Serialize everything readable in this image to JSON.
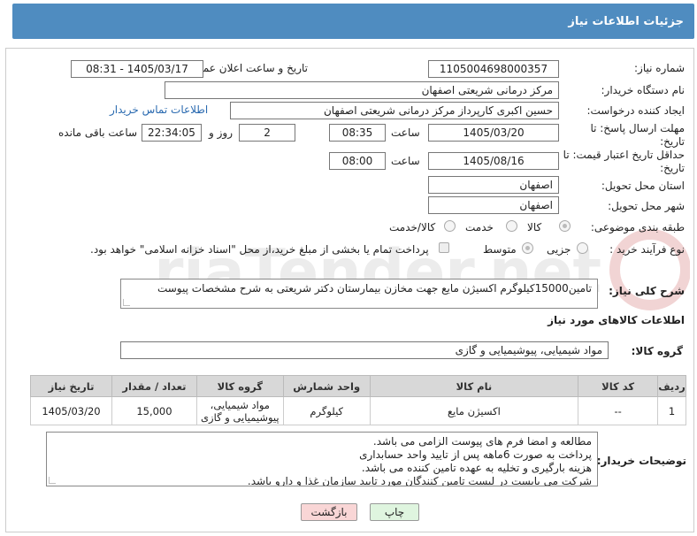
{
  "header": {
    "title": "جزئیات اطلاعات نیاز"
  },
  "form": {
    "need_number_label": "شماره نیاز:",
    "need_number": "1105004698000357",
    "announce_label": "تاریخ و ساعت اعلان عمومی:",
    "announce_value": "1405/03/17 - 08:31",
    "buyer_org_label": "نام دستگاه خریدار:",
    "buyer_org": "مرکز درمانی شریعتی اصفهان",
    "requester_label": "ایجاد کننده درخواست:",
    "requester": "حسین اکبری کارپرداز مرکز درمانی شریعتی اصفهان",
    "contact_link": "اطلاعات تماس خریدار",
    "deadline_label": "مهلت ارسال پاسخ: تا تاریخ:",
    "deadline_date": "1405/03/20",
    "time_label": "ساعت",
    "deadline_time": "08:35",
    "days_value": "2",
    "days_label": "روز و",
    "remaining_time": "22:34:05",
    "remaining_label": "ساعت باقی مانده",
    "price_valid_label": "حداقل تاریخ اعتبار قیمت: تا تاریخ:",
    "price_valid_date": "1405/08/16",
    "price_valid_time": "08:00",
    "province_label": "استان محل تحویل:",
    "province": "اصفهان",
    "city_label": "شهر محل تحویل:",
    "city": "اصفهان",
    "category_label": "طبقه بندی موضوعی:",
    "category_options": [
      "کالا",
      "خدمت",
      "کالا/خدمت"
    ],
    "process_label": "نوع فرآیند خرید :",
    "process_options": [
      "جزیی",
      "متوسط"
    ],
    "payment_note": "پرداخت تمام یا بخشی از مبلغ خرید،از محل \"اسناد خزانه اسلامی\" خواهد بود."
  },
  "summary": {
    "label": "شرح کلی نیاز:",
    "text": "تامین15000کیلوگرم اکسیژن مایع جهت مخازن بیمارستان دکتر شریعتی به شرح مشخصات پیوست"
  },
  "goods": {
    "section_title": "اطلاعات کالاهای مورد نیاز",
    "group_label": "گروه کالا:",
    "group_value": "مواد شیمیایی، پیوشیمیایی و  گازی",
    "columns": [
      "ردیف",
      "کد کالا",
      "نام کالا",
      "واحد شمارش",
      "گروه کالا",
      "تعداد / مقدار",
      "تاریخ نیاز"
    ],
    "rows": [
      {
        "index": "1",
        "code": "--",
        "name": "اکسیژن مایع",
        "unit": "کیلوگرم",
        "group": "مواد شیمیایی، پیوشیمیایی و گازی",
        "qty": "15,000",
        "date": "1405/03/20"
      }
    ]
  },
  "buyer_notes": {
    "label": "توضیحات خریدار:",
    "lines": [
      "مطالعه و امضا فرم های پیوست الزامی می باشد.",
      "پرداخت به صورت 6ماهه پس از تایید واحد حسابداری",
      "هزینه بارگیری و تخلیه به عهده تامین کننده می باشد.",
      "شرکت می بایست در لیست تامین کنندگان مورد تایید سازمان غذا و دارو باشد."
    ]
  },
  "buttons": {
    "print": "چاپ",
    "back": "بازگشت"
  },
  "colors": {
    "header": "#4f8cc0",
    "link": "#2a6ab0",
    "back_button": "#f9d6d6",
    "print_button": "#dff5df"
  }
}
